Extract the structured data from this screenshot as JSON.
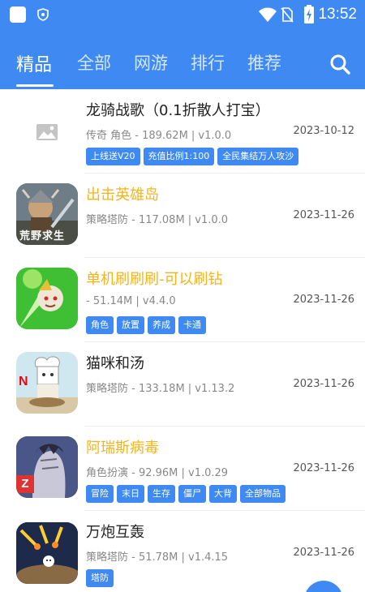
{
  "status_bar": {
    "time": "13:52"
  },
  "tabs": [
    {
      "label": "精品",
      "active": true
    },
    {
      "label": "全部"
    },
    {
      "label": "网游"
    },
    {
      "label": "排行"
    },
    {
      "label": "推荐"
    }
  ],
  "colors": {
    "accent": "#3f8af2",
    "highlight_title": "#f4b41a"
  },
  "apps": [
    {
      "title": "龙骑战歌（0.1折散人打宝）",
      "meta": "传奇 角色 - 189.62M | v1.0.0",
      "date": "2023-10-12",
      "tags": [
        "上线送V20",
        "充值比例1:100",
        "全民集结万人攻沙"
      ],
      "icon": "image-placeholder-icon"
    },
    {
      "title": "出击英雄岛",
      "meta": "策略塔防 - 117.08M | v1.0.0",
      "date": "2023-11-26",
      "tags": [],
      "icon": "game-icon-warrior",
      "icon_text": "荒野求生"
    },
    {
      "title": "单机刷刷刷-可以刷钻",
      "meta": "- 51.14M | v4.4.0",
      "date": "2023-11-26",
      "tags": [
        "角色",
        "放置",
        "养成",
        "卡通"
      ],
      "icon": "game-icon-green-creature"
    },
    {
      "title": "猫咪和汤",
      "meta": "策略塔防 - 133.18M | v1.13.2",
      "date": "2023-11-26",
      "tags": [],
      "icon": "game-icon-chef-cat",
      "icon_text": "N"
    },
    {
      "title": "阿瑞斯病毒",
      "meta": "角色扮演 - 92.96M | v1.0.29",
      "date": "2023-11-26",
      "tags": [
        "冒险",
        "末日",
        "生存",
        "僵尸",
        "大背",
        "全部物品"
      ],
      "icon": "game-icon-survivor",
      "icon_text": "Z"
    },
    {
      "title": "万炮互轰",
      "meta": "策略塔防 - 51.78M | v1.4.15",
      "date": "2023-11-26",
      "tags": [
        "塔防"
      ],
      "icon": "game-icon-cannons"
    }
  ]
}
